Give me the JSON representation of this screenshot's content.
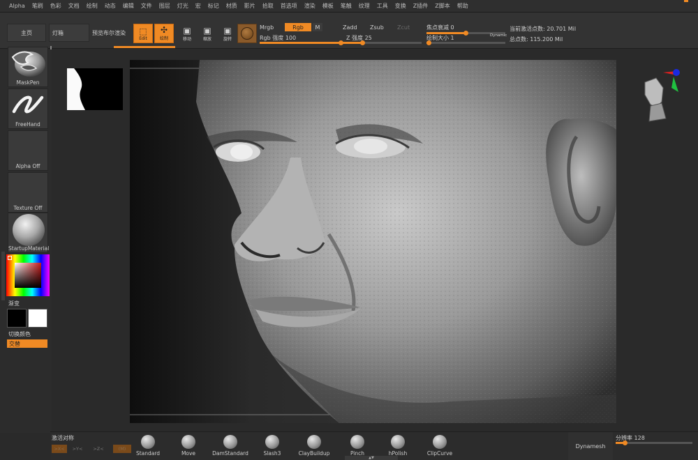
{
  "menu": {
    "items": [
      "Alpha",
      "笔刷",
      "色彩",
      "文档",
      "绘制",
      "动态",
      "编辑",
      "文件",
      "图层",
      "灯光",
      "宏",
      "标记",
      "材质",
      "影片",
      "拾取",
      "首选项",
      "渲染",
      "模板",
      "笔触",
      "纹理",
      "工具",
      "变换",
      "Z插件",
      "Z脚本",
      "帮助"
    ]
  },
  "toolbar": {
    "home": "主页",
    "lightbox": "灯箱",
    "bpr": "预览布尔渲染",
    "edit": "Edit",
    "draw": "绘制",
    "move": "移动",
    "scale": "缩放",
    "rotate": "旋转",
    "mrgb": "Mrgb",
    "rgb": "Rgb",
    "m": "M",
    "rgb_intensity_label": "Rgb 强度",
    "rgb_intensity_value": "100",
    "zadd": "Zadd",
    "zsub": "Zsub",
    "zcut": "Zcut",
    "z_intensity_label": "Z 强度",
    "z_intensity_value": "25",
    "focal_shift_label": "焦点衰减",
    "focal_shift_value": "0",
    "draw_size_label": "绘制大小",
    "draw_size_value": "1",
    "dynamic": "Dynamic",
    "active_points": "当前激活点数: 20.701 Mil",
    "total_points": "总点数: 115.200 Mil"
  },
  "left": {
    "brush": "MaskPen",
    "stroke": "FreeHand",
    "alpha": "Alpha Off",
    "texture": "Texture Off",
    "material": "StartupMaterial",
    "gradient": "渐变",
    "switch_color": "切换颜色",
    "alternate": "交替"
  },
  "bottom": {
    "symmetry": "激活对称",
    "axis_x": ">X<",
    "axis_y": ">Y<",
    "axis_z": ">Z<",
    "axis_m": "(M)",
    "brushes": [
      "Standard",
      "Move",
      "DamStandard",
      "Slash3",
      "ClayBuildup",
      "Pinch",
      "hPolish",
      "ClipCurve"
    ],
    "dynamesh": "Dynamesh",
    "resolution_label": "分辨率",
    "resolution_value": "128"
  },
  "colors": {
    "accent": "#f08a24",
    "panel": "#333333",
    "background": "#2a2a2a"
  },
  "sliders": {
    "rgb_intensity": 1.0,
    "z_intensity": 0.25,
    "focal_shift": 0.5,
    "draw_size": 0.01,
    "resolution": 0.12
  }
}
